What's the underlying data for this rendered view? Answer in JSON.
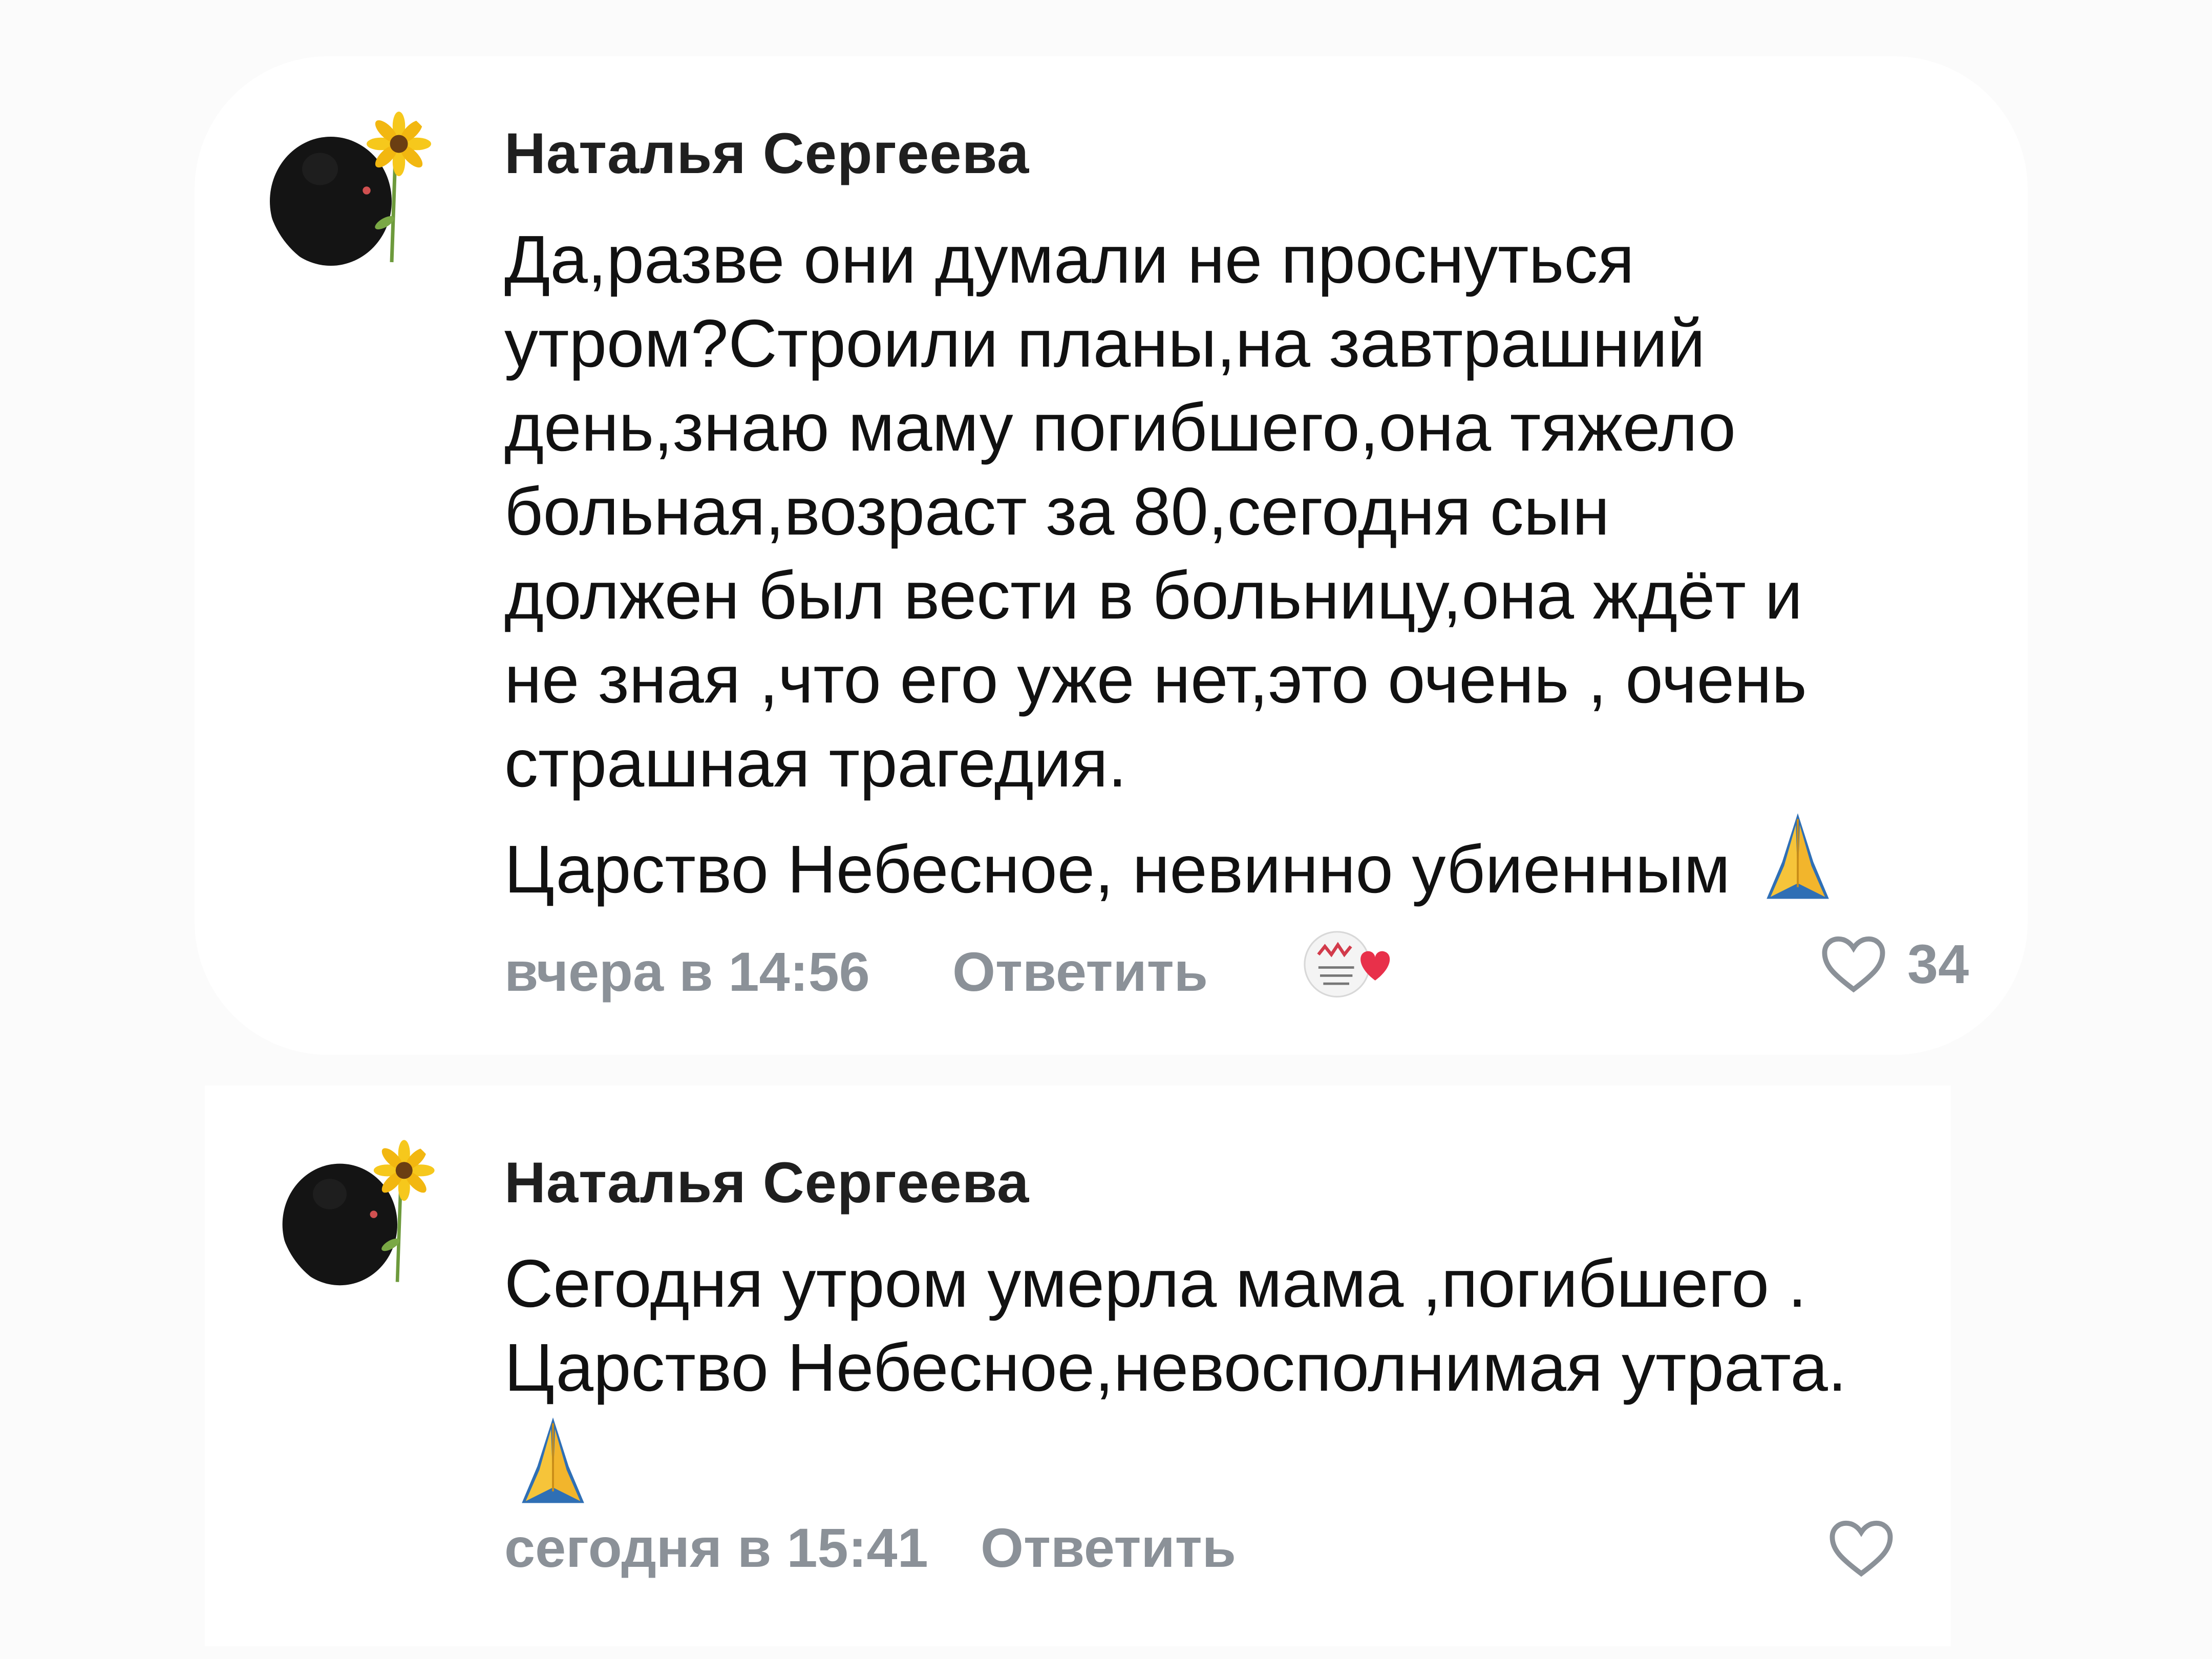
{
  "comments": [
    {
      "author": "Наталья Сергеева",
      "lines": [
        "Да,разве они думали не проснуться",
        "утром?Строили планы,на завтрашний",
        "день,знаю маму погибшего,она тяжело",
        "больная,возраст за 80,сегодня сын",
        "должен был вести в больницу,она ждёт и",
        "не зная ,что его уже нет,это очень , очень",
        "страшная трагедия.",
        "Царство Небесное, невинно убиенным"
      ],
      "trailing_emoji": "folded-hands-icon",
      "time": "вчера в 14:56",
      "reply_label": "Ответить",
      "like_count": "34"
    },
    {
      "author": "Наталья Сергеева",
      "lines": [
        "Сегодня утром умерла мама ,погибшего .",
        "Царство Небесное,невосполнимая утрата."
      ],
      "trailing_emoji": "folded-hands-icon",
      "time": "сегодня в 15:41",
      "reply_label": "Ответить"
    }
  ],
  "colors": {
    "author": "#1f1f1f",
    "text": "#111111",
    "meta": "#8b9198",
    "heart_badge": "#e8304a"
  }
}
